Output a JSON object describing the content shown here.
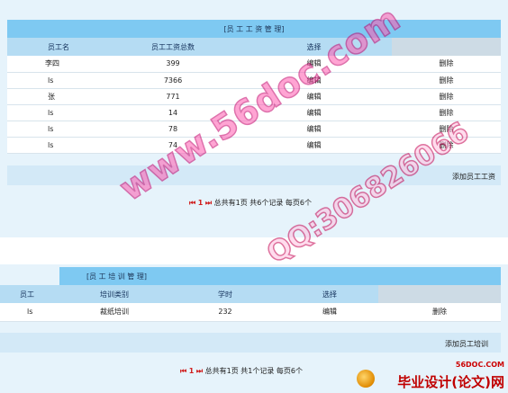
{
  "salary": {
    "title": "[员 工 工 资 管 理]",
    "headers": [
      "员工名",
      "员工工资总数",
      "选择"
    ],
    "rows": [
      {
        "name": "李四",
        "total": "399",
        "edit": "编辑",
        "del": "删除"
      },
      {
        "name": "ls",
        "total": "7366",
        "edit": "编辑",
        "del": "删除"
      },
      {
        "name": "张",
        "total": "771",
        "edit": "编辑",
        "del": "删除"
      },
      {
        "name": "ls",
        "total": "14",
        "edit": "编辑",
        "del": "删除"
      },
      {
        "name": "ls",
        "total": "78",
        "edit": "编辑",
        "del": "删除"
      },
      {
        "name": "ls",
        "total": "74",
        "edit": "编辑",
        "del": "删除"
      }
    ],
    "add_link": "添加员工工资",
    "pager": {
      "first": "⏮",
      "page": "1",
      "last": "⏭",
      "summary": "总共有1页  共6个记录  每页6个"
    }
  },
  "training": {
    "title": "[员 工 培 训 管 理]",
    "headers": [
      "员工",
      "培训类别",
      "学时",
      "选择"
    ],
    "rows": [
      {
        "name": "ls",
        "category": "裁纸培训",
        "hours": "232",
        "edit": "编辑",
        "del": "删除"
      }
    ],
    "add_link": "添加员工培训",
    "pager": {
      "first": "⏮",
      "page": "1",
      "last": "⏭",
      "summary": "总共有1页  共1个记录  每页6个"
    }
  },
  "watermarks": {
    "site": "www.56doc.com",
    "qq": "QQ:306826066"
  },
  "brand": {
    "domain": "56DOC.COM",
    "name": "毕业设计(论文)网"
  },
  "colors": {
    "title_bar": "#7ec9f2",
    "header": "#b5dcf3",
    "panel": "#e6f3fb",
    "pager_red": "#d02020"
  }
}
